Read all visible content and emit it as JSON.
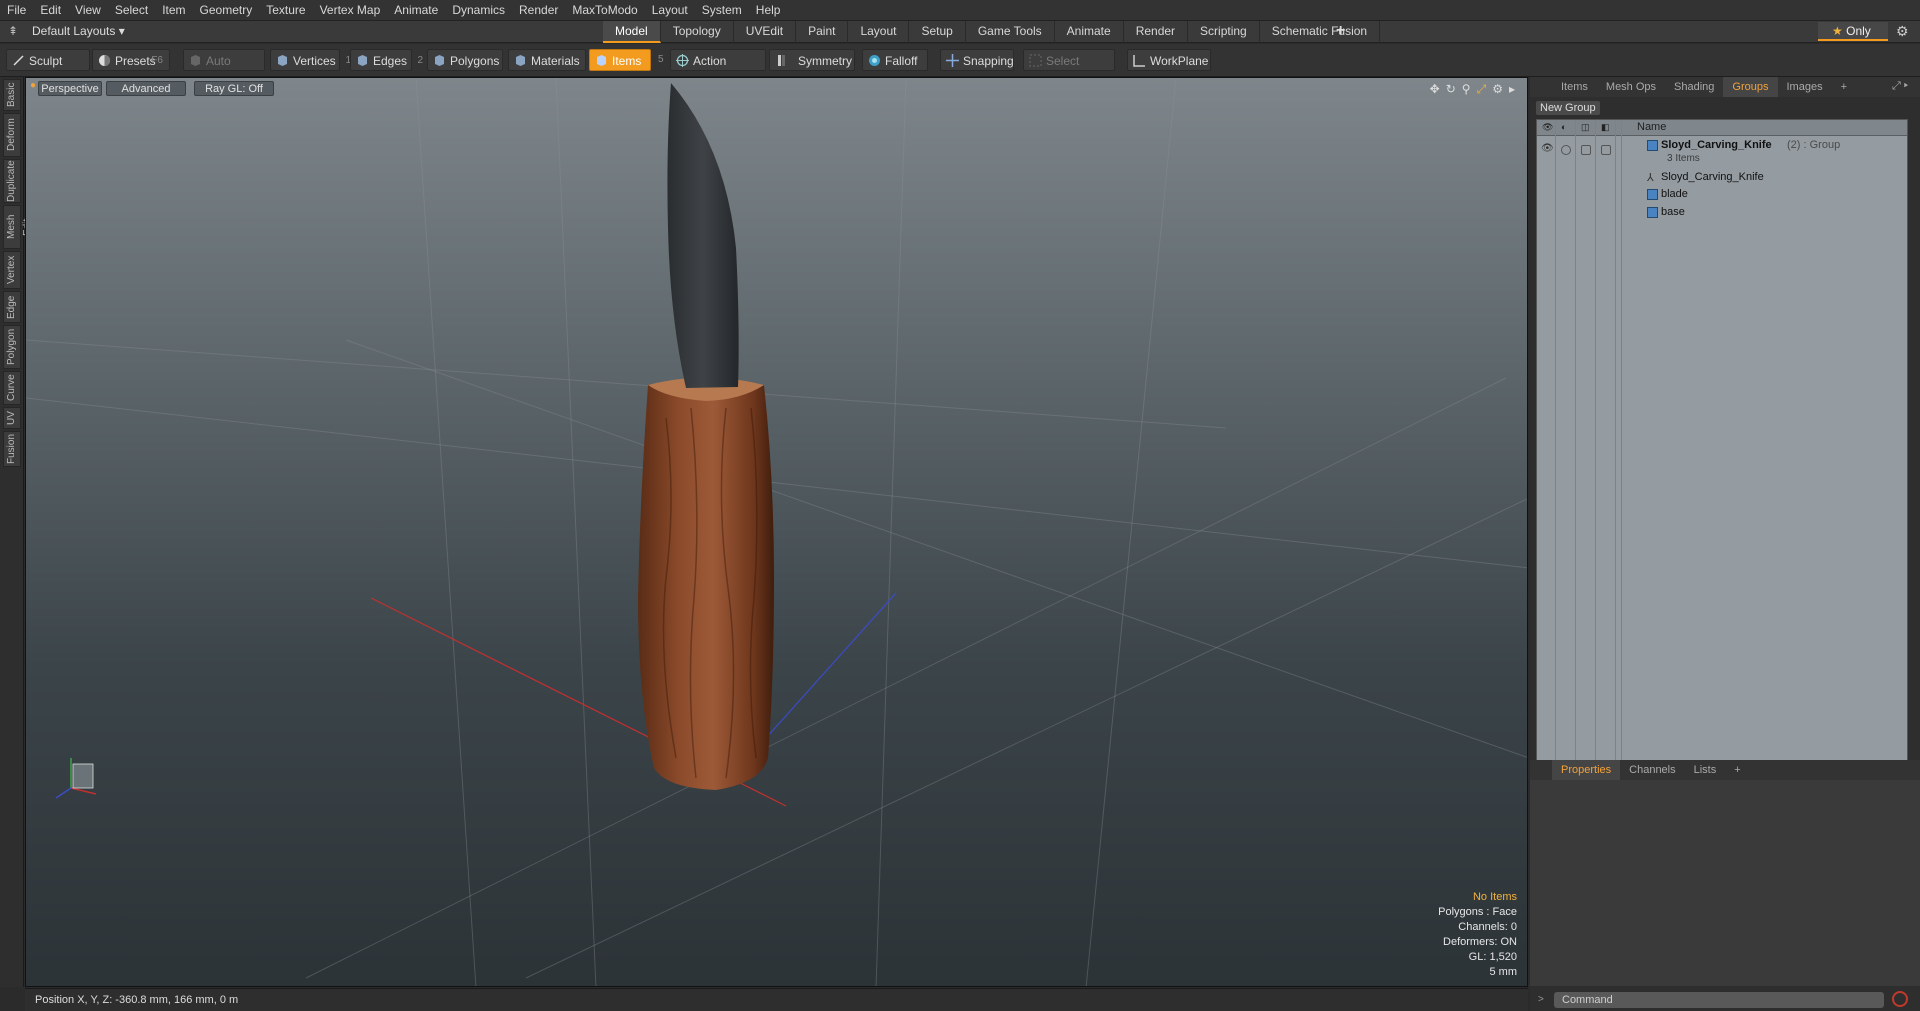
{
  "menu": [
    "File",
    "Edit",
    "View",
    "Select",
    "Item",
    "Geometry",
    "Texture",
    "Vertex Map",
    "Animate",
    "Dynamics",
    "Render",
    "MaxToModo",
    "Layout",
    "System",
    "Help"
  ],
  "layout_selector": "Default Layouts",
  "layout_tabs": [
    "Model",
    "Topology",
    "UVEdit",
    "Paint",
    "Layout",
    "Setup",
    "Game Tools",
    "Animate",
    "Render",
    "Scripting",
    "Schematic Fusion"
  ],
  "layout_plus": "+",
  "only_label": "Only",
  "toolbar": {
    "sculpt": "Sculpt",
    "presets": "Presets",
    "presets_key": "F6",
    "auto_select": "Auto Select",
    "vertices": "Vertices",
    "vertices_num": "1",
    "edges": "Edges",
    "edges_num": "2",
    "polygons": "Polygons",
    "materials": "Materials",
    "items": "Items",
    "items_num": "5",
    "action_center": "Action Center",
    "symmetry": "Symmetry",
    "falloff": "Falloff",
    "snapping": "Snapping",
    "select_through": "Select Through",
    "workplane": "WorkPlane"
  },
  "left_tabs": [
    "Basic",
    "Deform",
    "Duplicate",
    "Mesh Edit",
    "Vertex",
    "Edge",
    "Polygon",
    "Curve",
    "UV",
    "Fusion"
  ],
  "viewport": {
    "perspective": "Perspective",
    "advanced": "Advanced",
    "raygl": "Ray GL: Off",
    "stats": {
      "no_items": "No Items",
      "polygons": "Polygons : Face",
      "channels": "Channels: 0",
      "deformers": "Deformers: ON",
      "gl": "GL: 1,520",
      "scale": "5 mm"
    }
  },
  "status": "Position X, Y, Z:  -360.8 mm, 166 mm, 0 m",
  "right_panel": {
    "tabs": [
      "Items",
      "Mesh Ops",
      "Shading",
      "Groups",
      "Images",
      "+"
    ],
    "active_tab": "Groups",
    "new_group": "New Group",
    "name_header": "Name",
    "group_name": "Sloyd_Carving_Knife",
    "group_suffix": "(2) : Group",
    "group_count": "3 Items",
    "items": [
      "Sloyd_Carving_Knife",
      "blade",
      "base"
    ],
    "bottom_tabs": [
      "Properties",
      "Channels",
      "Lists",
      "+"
    ],
    "command_placeholder": "Command"
  }
}
